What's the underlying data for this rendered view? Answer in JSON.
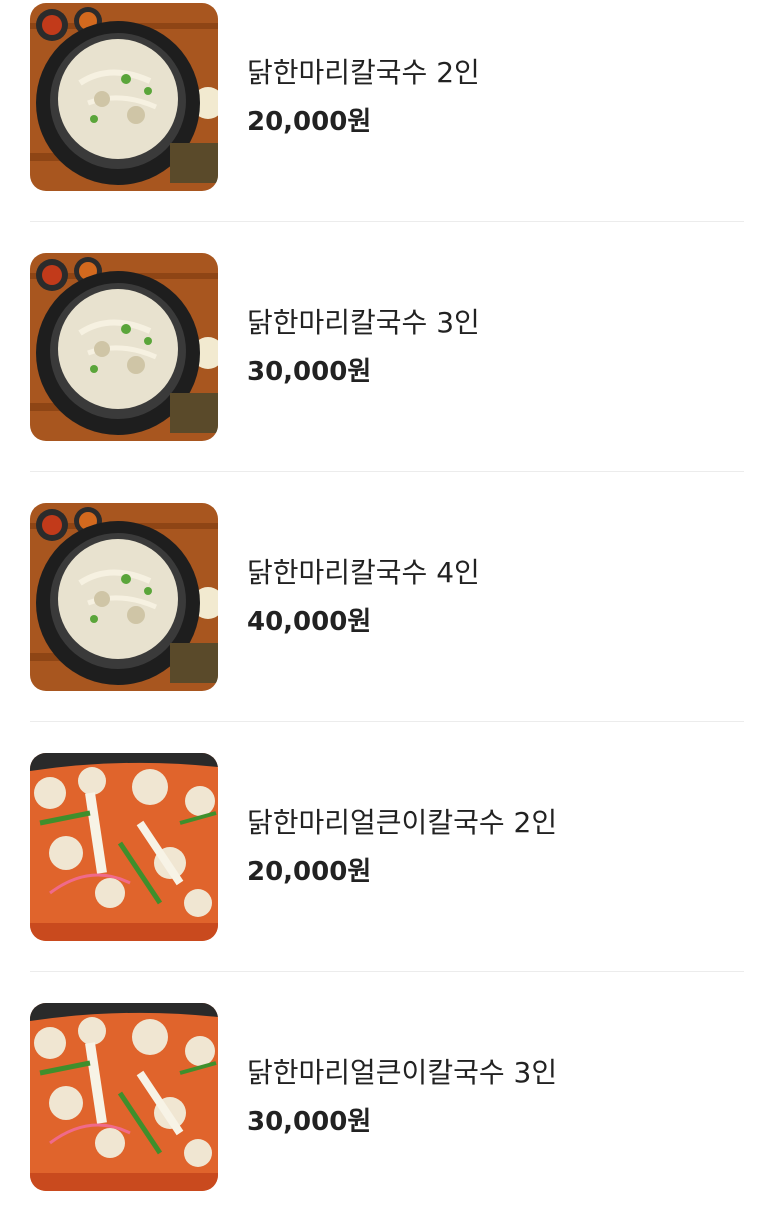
{
  "menu": {
    "items": [
      {
        "name": "닭한마리칼국수 2인",
        "price": "20,000원",
        "photo_icon": "white-broth-noodle-pot-photo"
      },
      {
        "name": "닭한마리칼국수 3인",
        "price": "30,000원",
        "photo_icon": "white-broth-noodle-pot-photo"
      },
      {
        "name": "닭한마리칼국수 4인",
        "price": "40,000원",
        "photo_icon": "white-broth-noodle-pot-photo"
      },
      {
        "name": "닭한마리얼큰이칼국수 2인",
        "price": "20,000원",
        "photo_icon": "spicy-red-broth-noodle-photo"
      },
      {
        "name": "닭한마리얼큰이칼국수 3인",
        "price": "30,000원",
        "photo_icon": "spicy-red-broth-noodle-photo"
      }
    ]
  },
  "colors": {
    "text": "#222222",
    "divider": "#ececec",
    "table_wood": "#a8561f",
    "white_broth": "#e8e2cf",
    "spicy_broth": "#e0642c"
  }
}
